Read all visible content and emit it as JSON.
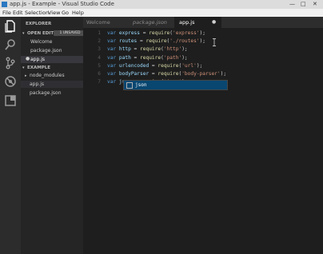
{
  "window": {
    "title": "app.js - Example - Visual Studio Code",
    "controls": [
      "—",
      "□",
      "✕"
    ]
  },
  "menu": [
    "File",
    "Edit",
    "Selection",
    "View",
    "Go",
    "Help"
  ],
  "activity_bar": {
    "icons": [
      "files-icon",
      "search-icon",
      "git-icon",
      "debug-icon",
      "extensions-icon"
    ]
  },
  "sidebar": {
    "header": "EXPLORER",
    "open_editors": {
      "label": "OPEN EDITORS",
      "badge": "1 UNSAVED",
      "files": [
        "Welcome",
        "package.json",
        "app.js"
      ]
    },
    "project": {
      "label": "EXAMPLE",
      "items": [
        "node_modules",
        "app.js",
        "package.json"
      ]
    }
  },
  "tabs": [
    {
      "label": "Welcome",
      "active": false
    },
    {
      "label": "package.json",
      "active": false
    },
    {
      "label": "app.js",
      "active": true
    }
  ],
  "editor": {
    "lines": [
      {
        "n": "1",
        "var": "express",
        "fn": "require",
        "arg": "'express'"
      },
      {
        "n": "2",
        "var": "routes",
        "fn": "require",
        "arg": "'./routes'"
      },
      {
        "n": "3",
        "var": "http",
        "fn": "require",
        "arg": "'http'"
      },
      {
        "n": "4",
        "var": "path",
        "fn": "require",
        "arg": "'path'"
      },
      {
        "n": "5",
        "var": "urlencoded",
        "fn": "require",
        "arg": "'url'"
      },
      {
        "n": "6",
        "var": "bodyParser",
        "fn": "require",
        "arg": "'body-parser'"
      },
      {
        "n": "7",
        "var": "json",
        "fn": "require",
        "arg": "'json'"
      }
    ],
    "keyword": "var"
  },
  "suggest": {
    "items": [
      "json"
    ]
  }
}
